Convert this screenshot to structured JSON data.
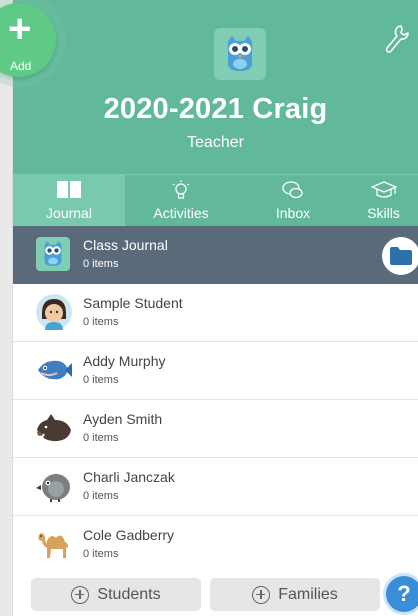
{
  "header": {
    "class_name": "2020-2021 Craig",
    "role": "Teacher",
    "add_label": "Add",
    "add_symbol": "+"
  },
  "tabs": [
    {
      "label": "Journal",
      "icon": "book-icon",
      "active": true
    },
    {
      "label": "Activities",
      "icon": "lightbulb-icon",
      "active": false
    },
    {
      "label": "Inbox",
      "icon": "chat-bubbles-icon",
      "active": false
    },
    {
      "label": "Skills",
      "icon": "graduation-cap-icon",
      "active": false
    }
  ],
  "journal": {
    "name": "Class Journal",
    "count": "0 items",
    "icon": "folder-icon"
  },
  "students": [
    {
      "name": "Sample Student",
      "count": "0 items",
      "avatar": "child-avatar"
    },
    {
      "name": "Addy Murphy",
      "count": "0 items",
      "avatar": "fish-avatar"
    },
    {
      "name": "Ayden Smith",
      "count": "0 items",
      "avatar": "boar-avatar"
    },
    {
      "name": "Charli Janczak",
      "count": "0 items",
      "avatar": "bird-avatar"
    },
    {
      "name": "Cole Gadberry",
      "count": "0 items",
      "avatar": "camel-avatar"
    }
  ],
  "footer": {
    "students_label": "Students",
    "families_label": "Families",
    "help_label": "?"
  },
  "colors": {
    "header_green": "#61b89d",
    "active_tab": "#78c9ae",
    "selected_row": "#5b6a7b",
    "add_button": "#5fca86",
    "help_blue": "#3a8ed8",
    "folder_blue": "#2f6fae"
  }
}
